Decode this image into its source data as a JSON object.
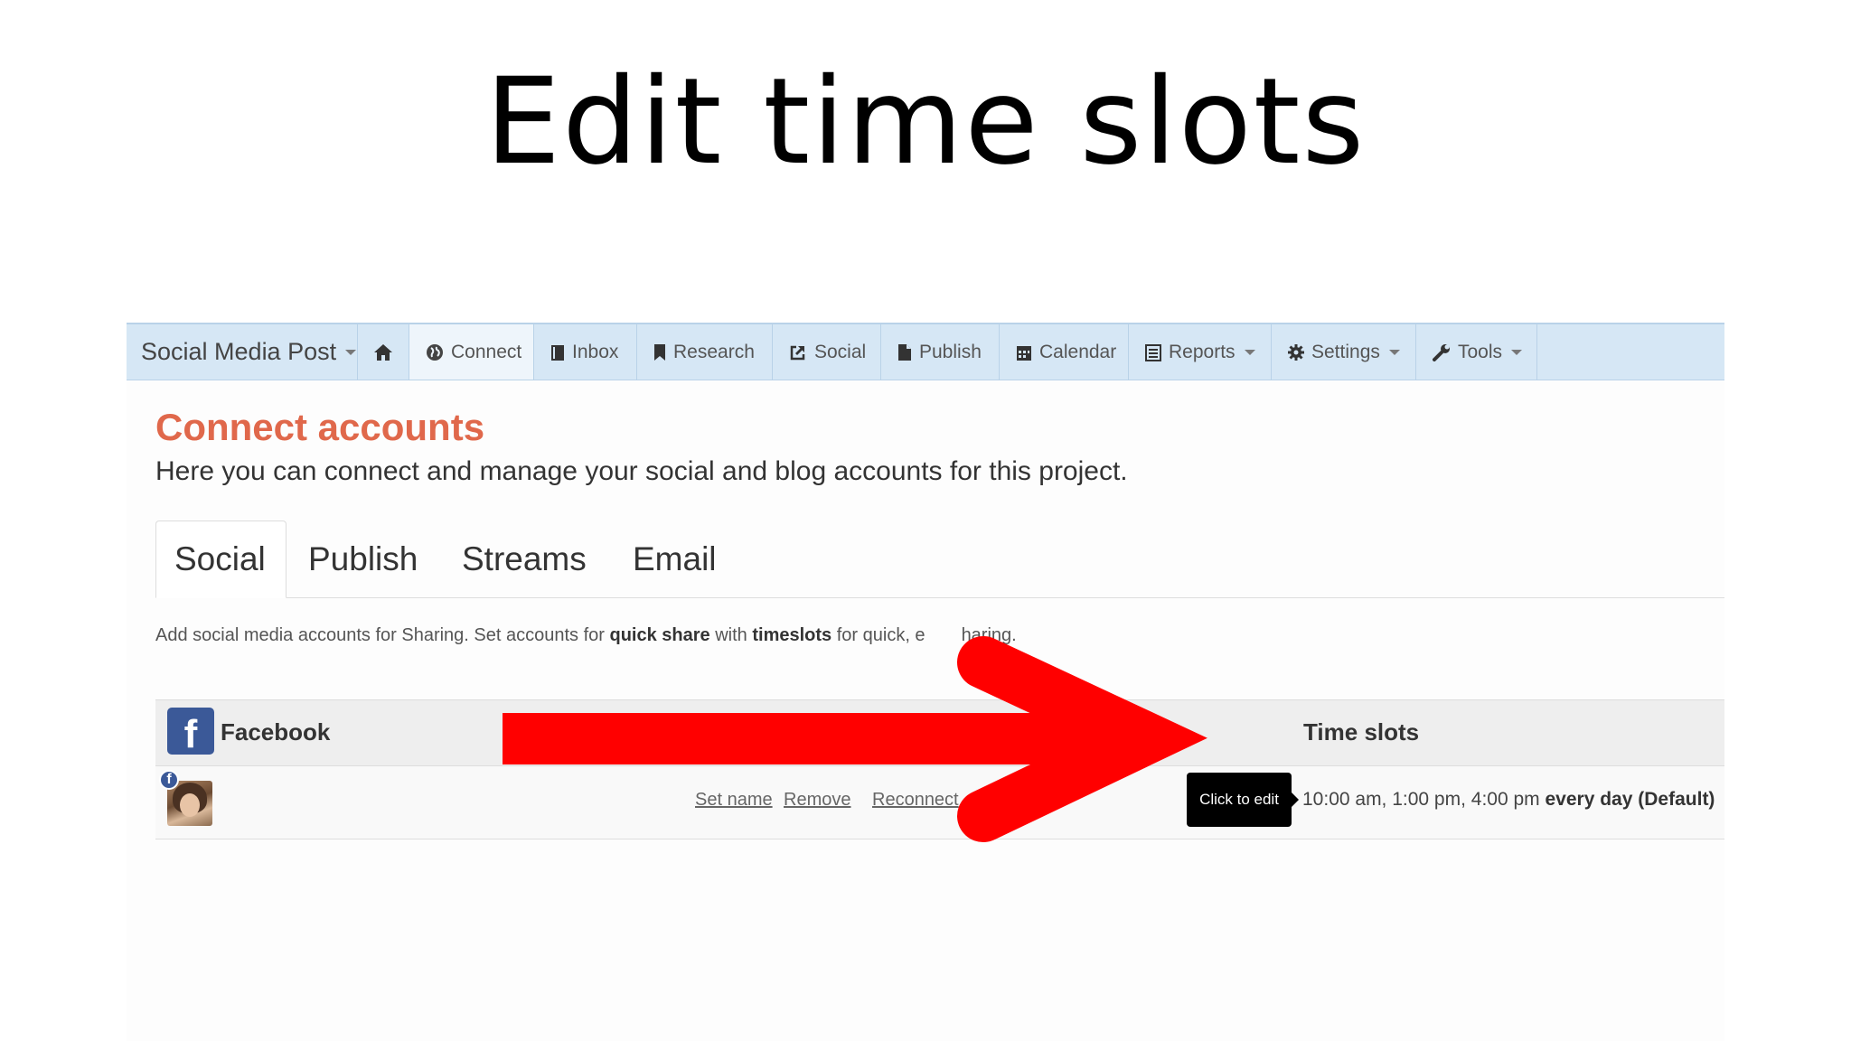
{
  "slide": {
    "title": "Edit time slots"
  },
  "navbar": {
    "brand": "Social Media Post",
    "items": [
      {
        "label": "Connect",
        "icon": "globe-icon"
      },
      {
        "label": "Inbox",
        "icon": "inbox-icon"
      },
      {
        "label": "Research",
        "icon": "bookmark-icon"
      },
      {
        "label": "Social",
        "icon": "share-icon"
      },
      {
        "label": "Publish",
        "icon": "file-icon"
      },
      {
        "label": "Calendar",
        "icon": "calendar-icon"
      },
      {
        "label": "Reports",
        "icon": "list-icon"
      },
      {
        "label": "Settings",
        "icon": "gear-icon"
      },
      {
        "label": "Tools",
        "icon": "wrench-icon"
      }
    ]
  },
  "page": {
    "heading": "Connect accounts",
    "subheading": "Here you can connect and manage your social and blog accounts for this project."
  },
  "tabs": [
    "Social",
    "Publish",
    "Streams",
    "Email"
  ],
  "help": {
    "part1": "Add social media accounts for Sharing. Set accounts for ",
    "bold1": "quick share",
    "part2": " with ",
    "bold2": "timeslots",
    "part3": " for quick, e",
    "part4": "haring."
  },
  "table": {
    "network": "Facebook",
    "timeslots_header": "Time slots",
    "row": {
      "links": [
        "Set name",
        "Remove",
        "Reconnect"
      ],
      "tooltip": "Click to edit",
      "times": "10:00 am, 1:00 pm, 4:00 pm",
      "every": "every day",
      "default": "(Default)"
    }
  },
  "colors": {
    "heading": "#e0684b",
    "navbar": "#d6e7f5",
    "facebook": "#3b5998",
    "arrow": "#ff0000"
  }
}
